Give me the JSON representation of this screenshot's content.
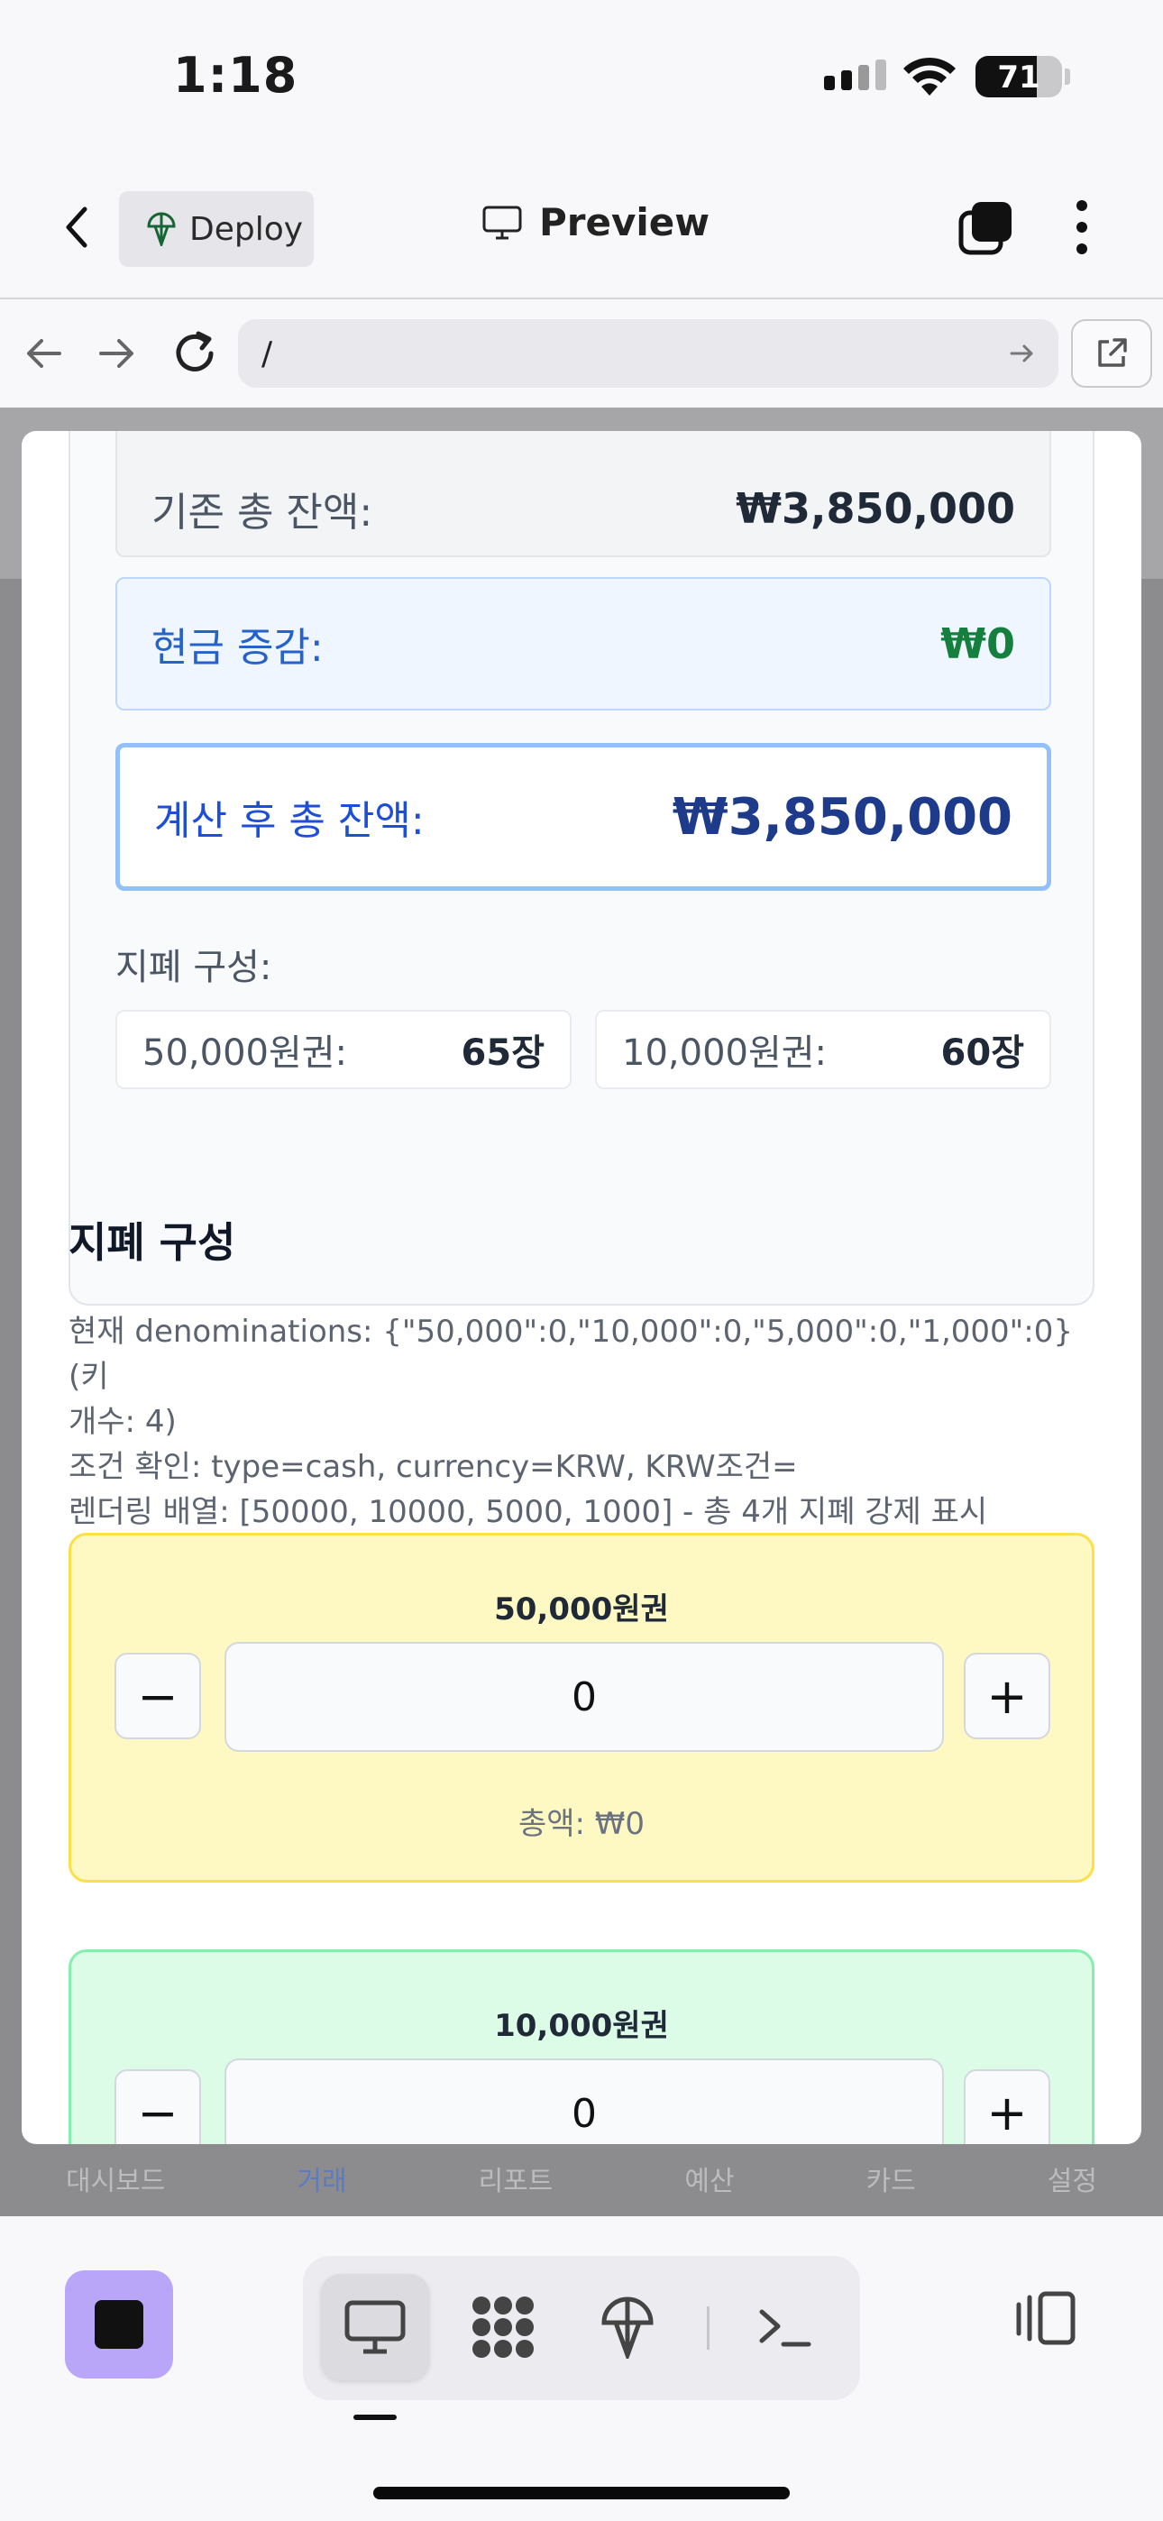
{
  "status_bar": {
    "time": "1:18",
    "battery": "71",
    "battery_fraction": 0.71
  },
  "header": {
    "deploy_label": "Deploy",
    "preview_label": "Preview"
  },
  "urlbar": {
    "url": "/"
  },
  "behind_tabs": [
    "대시보드",
    "거래",
    "리포트",
    "예산",
    "카드",
    "설정"
  ],
  "summary": {
    "base_label": "기존 총 잔액:",
    "base_value": "₩3,850,000",
    "cash_change_label": "현금 증감:",
    "cash_change_value": "₩0",
    "after_label": "계산 후 총 잔액:",
    "after_value": "₩3,850,000",
    "composition_label": "지폐 구성:",
    "bills": [
      {
        "label": "50,000원권:",
        "count": "65장"
      },
      {
        "label": "10,000원권:",
        "count": "60장"
      }
    ]
  },
  "denominations": {
    "title": "지폐 구성",
    "debug_line1": "현재 denominations: {\"50,000\":0,\"10,000\":0,\"5,000\":0,\"1,000\":0} (키",
    "debug_line2": "개수: 4)",
    "debug_line3": "조건 확인: type=cash, currency=KRW, KRW조건=",
    "debug_line4": "렌더링 배열: [50000, 10000, 5000, 1000] - 총 4개 지폐 강제 표시",
    "items": [
      {
        "title": "50,000원권",
        "quantity": "0",
        "total": "총액: ₩0",
        "minus": "−",
        "plus": "+",
        "color": "#fef9c3"
      },
      {
        "title": "10,000원권",
        "quantity": "0",
        "minus": "−",
        "plus": "+",
        "color": "#dcfce7"
      }
    ]
  },
  "colors": {
    "accent_purple": "#b9a6f8",
    "positive_green": "#15803d",
    "primary_blue": "#1d4ed8"
  },
  "toolbar": {
    "tools": [
      "monitor-icon",
      "apps-icon",
      "deploy-icon",
      "terminal-icon"
    ],
    "active_tool": "monitor-icon"
  }
}
